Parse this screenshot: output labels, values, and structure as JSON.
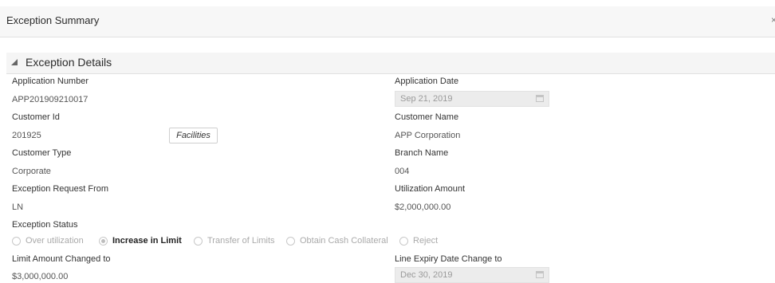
{
  "header": {
    "title": "Exception Summary",
    "close_glyph": "×"
  },
  "section": {
    "title": "Exception Details"
  },
  "fields": {
    "application_number": {
      "label": "Application Number",
      "value": "APP201909210017"
    },
    "application_date": {
      "label": "Application Date",
      "value": "Sep 21, 2019"
    },
    "customer_id": {
      "label": "Customer Id",
      "value": "201925"
    },
    "facilities_button": "Facilities",
    "customer_name": {
      "label": "Customer Name",
      "value": "APP Corporation"
    },
    "customer_type": {
      "label": "Customer Type",
      "value": "Corporate"
    },
    "branch_name": {
      "label": "Branch Name",
      "value": "004"
    },
    "exception_request_from": {
      "label": "Exception Request From",
      "value": "LN"
    },
    "utilization_amount": {
      "label": "Utilization Amount",
      "value": "$2,000,000.00"
    },
    "limit_amount_changed_to": {
      "label": "Limit Amount Changed to",
      "value": "$3,000,000.00"
    },
    "line_expiry_date_change_to": {
      "label": "Line Expiry Date Change to",
      "value": "Dec 30, 2019"
    }
  },
  "exception_status": {
    "label": "Exception Status",
    "selected": "Increase in Limit",
    "options": [
      "Over utilization",
      "Increase in Limit",
      "Transfer of Limits",
      "Obtain Cash Collateral",
      "Reject"
    ]
  },
  "icons": {
    "section_toggle": "triangle-down-icon",
    "date_picker": "calendar-icon"
  }
}
